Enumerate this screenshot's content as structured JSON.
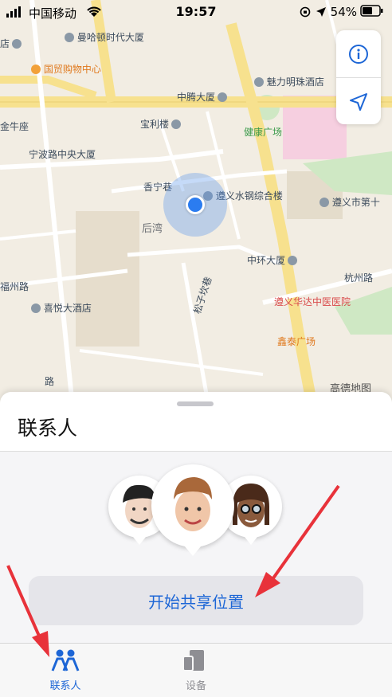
{
  "status_bar": {
    "carrier": "中国移动",
    "time": "19:57",
    "battery": "54%"
  },
  "map": {
    "labels": {
      "manhattan": "曼哈顿时代大厦",
      "guomao": "国贸购物中心",
      "meili": "魅力明珠酒店",
      "zhongteng": "中腾大厦",
      "baoli": "宝利楼",
      "jinniu": "金牛座",
      "jiankang": "健康广场",
      "ningbo": "宁波路中央大厦",
      "xiangning": "香宁巷",
      "zunyi_steel": "遵义水钢综合楼",
      "zunyi_city": "遵义市第十",
      "houwan": "后湾",
      "zhonghuan": "中环大厦",
      "fuzhou": "福州路",
      "hangzhou": "杭州路",
      "songzi": "松子坎巷",
      "xiyue": "喜悦大酒店",
      "huada": "遵义华达中医医院",
      "xintai": "鑫泰广场",
      "road_lu": "路",
      "dian": "店"
    },
    "watermark": "高德地图"
  },
  "controls": {
    "info_icon": "info-icon",
    "locate_icon": "location-arrow-icon"
  },
  "sheet": {
    "title": "联系人",
    "share_button": "开始共享位置"
  },
  "tabs": [
    {
      "label": "联系人",
      "icon": "people-icon",
      "active": true
    },
    {
      "label": "设备",
      "icon": "devices-icon",
      "active": false
    }
  ],
  "colors": {
    "accent": "#1d66d6",
    "annotation_arrow": "#e8323a"
  }
}
